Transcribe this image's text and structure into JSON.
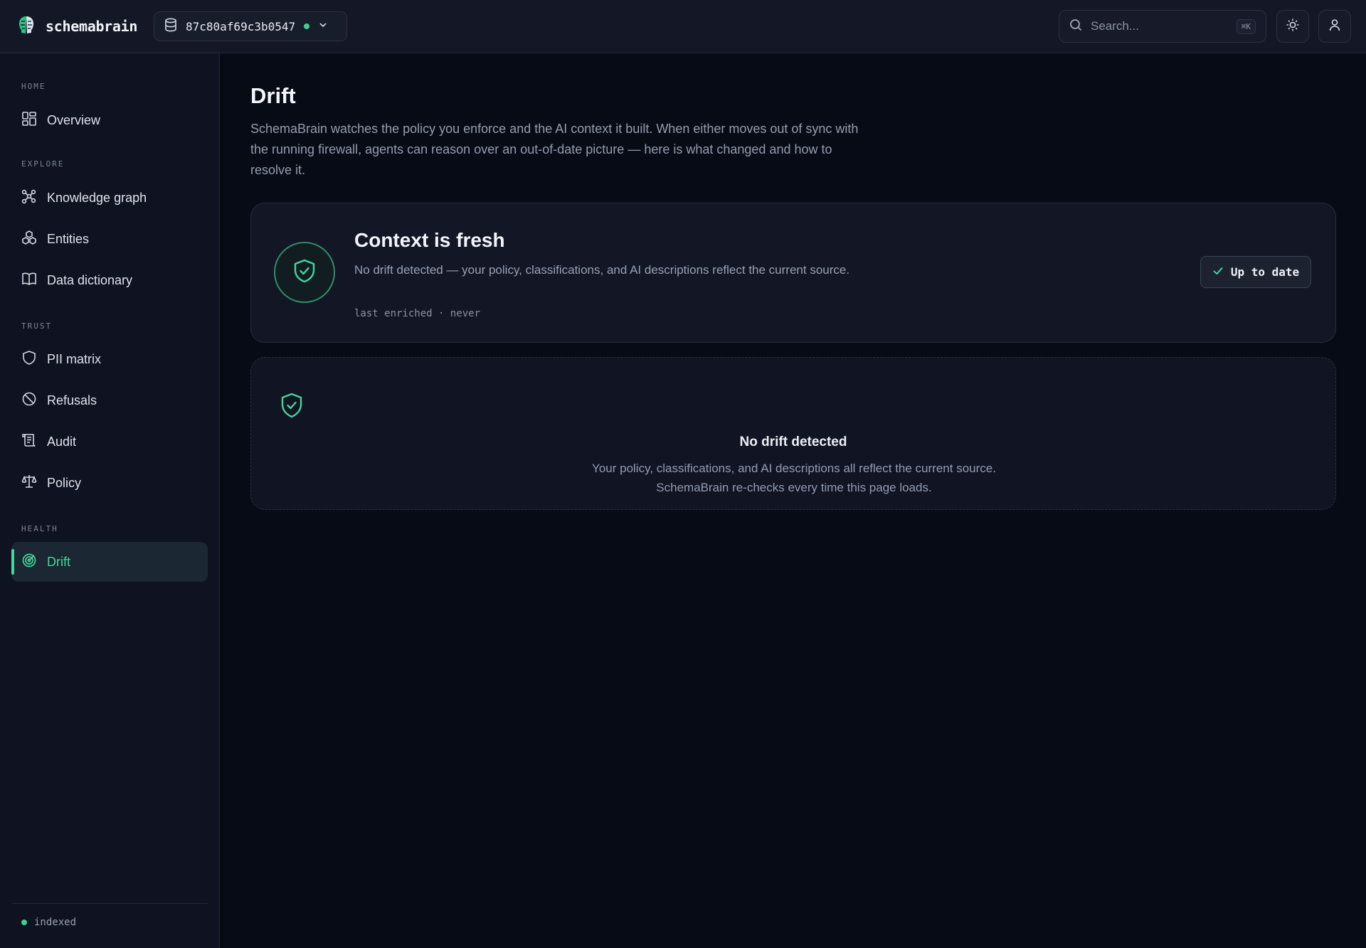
{
  "app": {
    "name": "schemabrain"
  },
  "database": {
    "id": "87c80af69c3b0547",
    "status_color": "#3ecf8e"
  },
  "search": {
    "placeholder": "Search...",
    "shortcut": "⌘K"
  },
  "sidebar": {
    "sections": [
      {
        "label": "HOME",
        "items": [
          {
            "label": "Overview",
            "icon": "grid-icon"
          }
        ]
      },
      {
        "label": "EXPLORE",
        "items": [
          {
            "label": "Knowledge graph",
            "icon": "graph-icon"
          },
          {
            "label": "Entities",
            "icon": "entities-icon"
          },
          {
            "label": "Data dictionary",
            "icon": "book-icon"
          }
        ]
      },
      {
        "label": "TRUST",
        "items": [
          {
            "label": "PII matrix",
            "icon": "shield-icon"
          },
          {
            "label": "Refusals",
            "icon": "ban-icon"
          },
          {
            "label": "Audit",
            "icon": "scroll-icon"
          },
          {
            "label": "Policy",
            "icon": "scale-icon"
          }
        ]
      },
      {
        "label": "HEALTH",
        "items": [
          {
            "label": "Drift",
            "icon": "radar-icon",
            "active": true
          }
        ]
      }
    ],
    "footer_status": "indexed"
  },
  "page": {
    "title": "Drift",
    "description": "SchemaBrain watches the policy you enforce and the AI context it built. When either moves out of sync with the running firewall, agents can reason over an out-of-date picture — here is what changed and how to resolve it."
  },
  "status_card": {
    "title": "Context is fresh",
    "description": "No drift detected — your policy, classifications, and AI descriptions reflect the current source.",
    "meta": "last enriched · never",
    "badge": "Up to date"
  },
  "empty_state": {
    "title": "No drift detected",
    "description": "Your policy, classifications, and AI descriptions all reflect the current source. SchemaBrain re-checks every time this page loads."
  },
  "colors": {
    "accent": "#45d69a",
    "background": "#070b16"
  }
}
